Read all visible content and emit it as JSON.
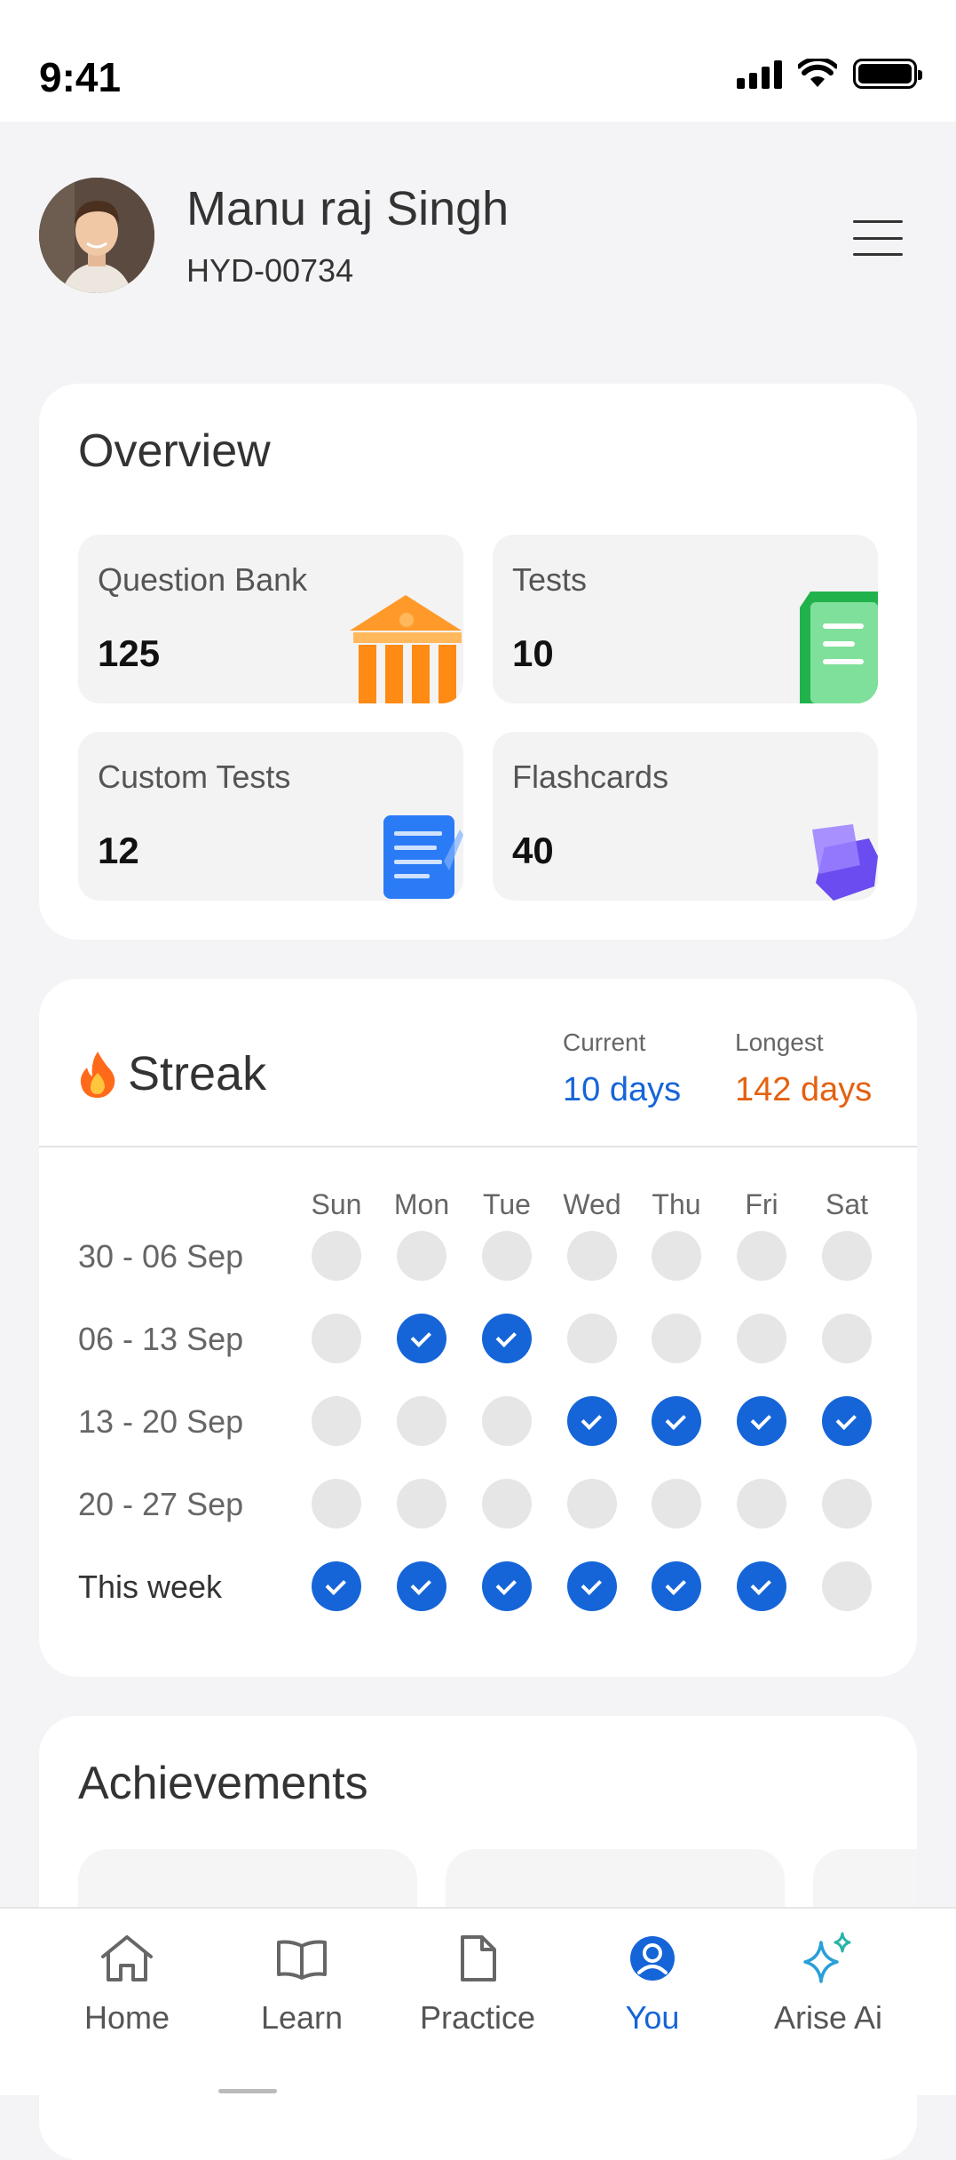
{
  "status": {
    "time": "9:41"
  },
  "profile": {
    "name": "Manu raj Singh",
    "id": "HYD-00734"
  },
  "overview": {
    "title": "Overview",
    "tiles": [
      {
        "label": "Question Bank",
        "value": "125",
        "icon": "bank-icon"
      },
      {
        "label": "Tests",
        "value": "10",
        "icon": "test-sheet-icon"
      },
      {
        "label": "Custom Tests",
        "value": "12",
        "icon": "notepad-icon"
      },
      {
        "label": "Flashcards",
        "value": "40",
        "icon": "flashcard-stack-icon"
      }
    ]
  },
  "streak": {
    "title": "Streak",
    "current_label": "Current",
    "current_value": "10 days",
    "longest_label": "Longest",
    "longest_value": "142 days",
    "days": [
      "Sun",
      "Mon",
      "Tue",
      "Wed",
      "Thu",
      "Fri",
      "Sat"
    ],
    "weeks": [
      {
        "label": "30 - 06 Sep",
        "done": [
          false,
          false,
          false,
          false,
          false,
          false,
          false
        ]
      },
      {
        "label": "06 - 13 Sep",
        "done": [
          false,
          true,
          true,
          false,
          false,
          false,
          false
        ]
      },
      {
        "label": "13 - 20 Sep",
        "done": [
          false,
          false,
          false,
          true,
          true,
          true,
          true
        ]
      },
      {
        "label": "20 - 27 Sep",
        "done": [
          false,
          false,
          false,
          false,
          false,
          false,
          false
        ]
      },
      {
        "label": "This week",
        "done": [
          true,
          true,
          true,
          true,
          true,
          true,
          false
        ]
      }
    ],
    "colors": {
      "done": "#1565d8",
      "current": "#1565d8",
      "longest": "#e4610f"
    }
  },
  "achievements": {
    "title": "Achievements"
  },
  "nav": {
    "items": [
      {
        "label": "Home",
        "icon": "home-icon"
      },
      {
        "label": "Learn",
        "icon": "book-icon"
      },
      {
        "label": "Practice",
        "icon": "document-icon"
      },
      {
        "label": "You",
        "icon": "user-icon",
        "active": true
      },
      {
        "label": "Arise Ai",
        "icon": "sparkle-icon"
      }
    ]
  }
}
